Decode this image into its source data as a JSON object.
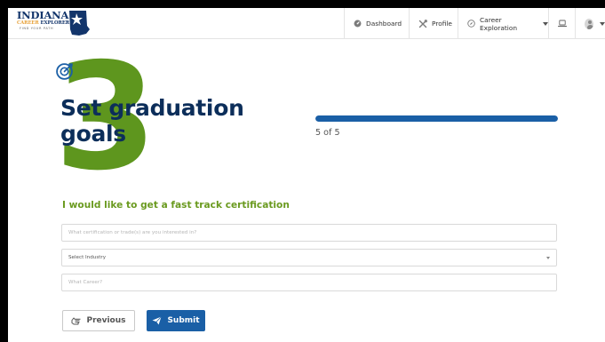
{
  "brand": {
    "name": "INDIANA",
    "sub_career": "CAREER",
    "sub_explorer": "EXPLORER",
    "tagline": "FIND YOUR PATH"
  },
  "nav": {
    "dashboard": "Dashboard",
    "profile": "Profile",
    "career_exploration": "Career Exploration"
  },
  "step": {
    "number": "3",
    "title": "Set graduation goals",
    "progress_text": "5 of 5",
    "progress_fraction": 1.0
  },
  "form": {
    "heading": "I would like to get a fast track certification",
    "certification_placeholder": "What certification or trade(s) are you interested in?",
    "industry_selected": "Select Industry",
    "career_placeholder": "What Career?",
    "previous_label": "Previous",
    "submit_label": "Submit"
  },
  "colors": {
    "navy": "#0c2e5a",
    "accent_blue": "#1a5fa6",
    "accent_green": "#6a9a1f",
    "logo_gold": "#e8a33b"
  }
}
